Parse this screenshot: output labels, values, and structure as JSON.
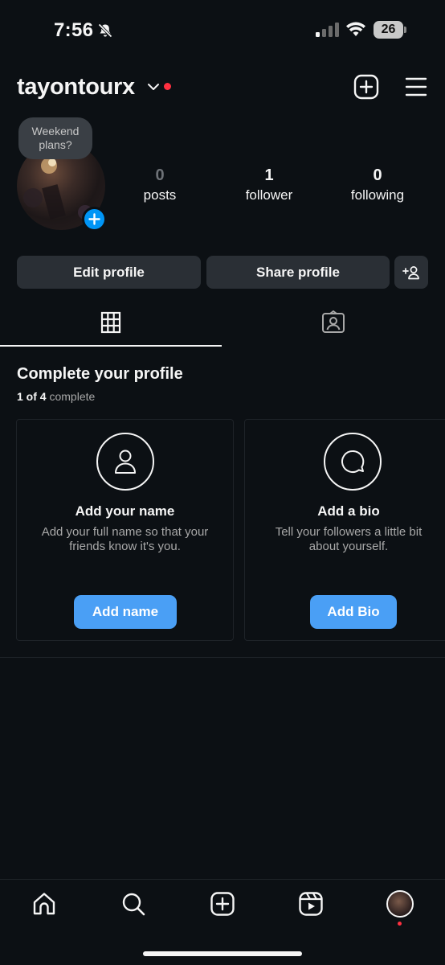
{
  "status_bar": {
    "time": "7:56",
    "battery": "26"
  },
  "header": {
    "username": "tayontourx"
  },
  "note": {
    "text": "Weekend plans?"
  },
  "stats": [
    {
      "value": "0",
      "label": "posts"
    },
    {
      "value": "1",
      "label": "follower"
    },
    {
      "value": "0",
      "label": "following"
    }
  ],
  "actions": {
    "edit_profile": "Edit profile",
    "share_profile": "Share profile"
  },
  "complete_profile": {
    "title": "Complete your profile",
    "progress_count": "1 of 4",
    "progress_word": "complete",
    "cards": [
      {
        "title": "Add your name",
        "description": "Add your full name so that your friends know it's you.",
        "button": "Add name",
        "icon": "person-icon"
      },
      {
        "title": "Add a bio",
        "description": "Tell your followers a little bit about yourself.",
        "button": "Add Bio",
        "icon": "speech-bubble-icon"
      }
    ]
  },
  "colors": {
    "background": "#0c1014",
    "accent_blue": "#4a9ff5",
    "notification_red": "#ff3040"
  }
}
